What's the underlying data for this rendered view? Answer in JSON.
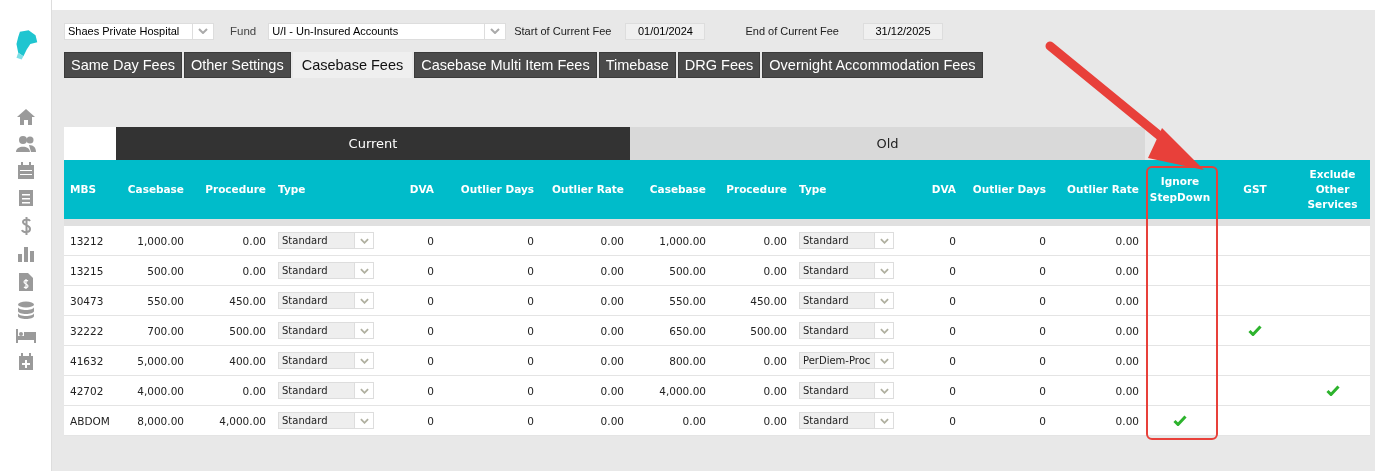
{
  "filters": {
    "hospital": "Shaes Private Hospital",
    "fund_label": "Fund",
    "fund": "U/I - Un-Insured Accounts",
    "start_label": "Start of Current Fee",
    "start_date": "01/01/2024",
    "end_label": "End of Current Fee",
    "end_date": "31/12/2025"
  },
  "tabs": [
    {
      "label": "Same Day Fees",
      "selected": false
    },
    {
      "label": "Other Settings",
      "selected": false
    },
    {
      "label": "Casebase Fees",
      "selected": true
    },
    {
      "label": "Casebase Multi Item Fees",
      "selected": false
    },
    {
      "label": "Timebase",
      "selected": false
    },
    {
      "label": "DRG Fees",
      "selected": false
    },
    {
      "label": "Overnight Accommodation Fees",
      "selected": false
    }
  ],
  "table": {
    "groups": [
      "Current",
      "Old"
    ],
    "columns": [
      "MBS",
      "Casebase",
      "Procedure",
      "Type",
      "DVA",
      "Outlier Days",
      "Outlier Rate",
      "Casebase",
      "Procedure",
      "Type",
      "DVA",
      "Outlier Days",
      "Outlier Rate",
      "Ignore StepDown",
      "GST",
      "Exclude Other Services"
    ],
    "rows": [
      {
        "mbs": "13212",
        "cur_casebase": "1,000.00",
        "cur_procedure": "0.00",
        "cur_type": "Standard",
        "cur_dva": "0",
        "cur_outlier_days": "0",
        "cur_outlier_rate": "0.00",
        "old_casebase": "1,000.00",
        "old_procedure": "0.00",
        "old_type": "Standard",
        "old_dva": "0",
        "old_outlier_days": "0",
        "old_outlier_rate": "0.00",
        "ignore_stepdown": false,
        "gst": false,
        "exclude_other_services": false
      },
      {
        "mbs": "13215",
        "cur_casebase": "500.00",
        "cur_procedure": "0.00",
        "cur_type": "Standard",
        "cur_dva": "0",
        "cur_outlier_days": "0",
        "cur_outlier_rate": "0.00",
        "old_casebase": "500.00",
        "old_procedure": "0.00",
        "old_type": "Standard",
        "old_dva": "0",
        "old_outlier_days": "0",
        "old_outlier_rate": "0.00",
        "ignore_stepdown": false,
        "gst": false,
        "exclude_other_services": false
      },
      {
        "mbs": "30473",
        "cur_casebase": "550.00",
        "cur_procedure": "450.00",
        "cur_type": "Standard",
        "cur_dva": "0",
        "cur_outlier_days": "0",
        "cur_outlier_rate": "0.00",
        "old_casebase": "550.00",
        "old_procedure": "450.00",
        "old_type": "Standard",
        "old_dva": "0",
        "old_outlier_days": "0",
        "old_outlier_rate": "0.00",
        "ignore_stepdown": false,
        "gst": false,
        "exclude_other_services": false
      },
      {
        "mbs": "32222",
        "cur_casebase": "700.00",
        "cur_procedure": "500.00",
        "cur_type": "Standard",
        "cur_dva": "0",
        "cur_outlier_days": "0",
        "cur_outlier_rate": "0.00",
        "old_casebase": "650.00",
        "old_procedure": "500.00",
        "old_type": "Standard",
        "old_dva": "0",
        "old_outlier_days": "0",
        "old_outlier_rate": "0.00",
        "ignore_stepdown": false,
        "gst": true,
        "exclude_other_services": false
      },
      {
        "mbs": "41632",
        "cur_casebase": "5,000.00",
        "cur_procedure": "400.00",
        "cur_type": "Standard",
        "cur_dva": "0",
        "cur_outlier_days": "0",
        "cur_outlier_rate": "0.00",
        "old_casebase": "800.00",
        "old_procedure": "0.00",
        "old_type": "PerDiem-Proc",
        "old_dva": "0",
        "old_outlier_days": "0",
        "old_outlier_rate": "0.00",
        "ignore_stepdown": false,
        "gst": false,
        "exclude_other_services": false
      },
      {
        "mbs": "42702",
        "cur_casebase": "4,000.00",
        "cur_procedure": "0.00",
        "cur_type": "Standard",
        "cur_dva": "0",
        "cur_outlier_days": "0",
        "cur_outlier_rate": "0.00",
        "old_casebase": "4,000.00",
        "old_procedure": "0.00",
        "old_type": "Standard",
        "old_dva": "0",
        "old_outlier_days": "0",
        "old_outlier_rate": "0.00",
        "ignore_stepdown": false,
        "gst": false,
        "exclude_other_services": true
      },
      {
        "mbs": "ABDOM",
        "cur_casebase": "8,000.00",
        "cur_procedure": "4,000.00",
        "cur_type": "Standard",
        "cur_dva": "0",
        "cur_outlier_days": "0",
        "cur_outlier_rate": "0.00",
        "old_casebase": "0.00",
        "old_procedure": "0.00",
        "old_type": "Standard",
        "old_dva": "0",
        "old_outlier_days": "0",
        "old_outlier_rate": "0.00",
        "ignore_stepdown": true,
        "gst": false,
        "exclude_other_services": false
      }
    ]
  }
}
